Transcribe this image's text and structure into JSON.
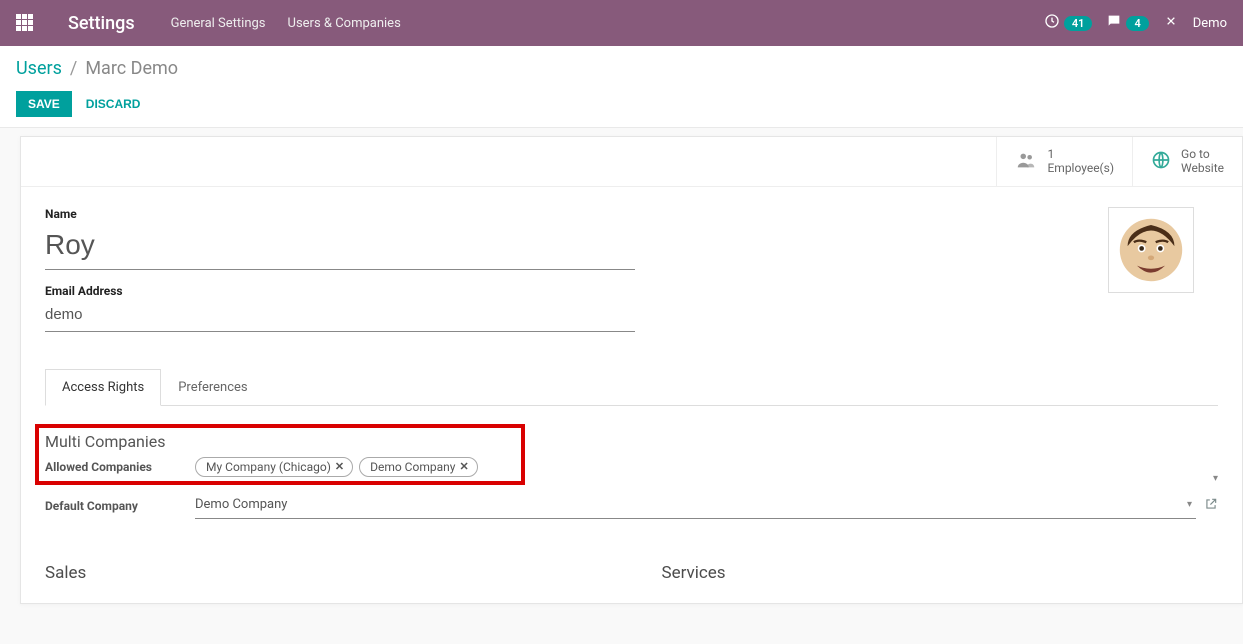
{
  "navbar": {
    "brand": "Settings",
    "links": {
      "general": "General Settings",
      "users_companies": "Users & Companies"
    },
    "badge_activity": "41",
    "badge_discuss": "4",
    "username": "Demo"
  },
  "breadcrumb": {
    "root": "Users",
    "sep": "/",
    "current": "Marc Demo"
  },
  "buttons": {
    "save": "SAVE",
    "discard": "DISCARD"
  },
  "stat": {
    "employees_count": "1",
    "employees_label": "Employee(s)",
    "goto1": "Go to",
    "goto2": "Website"
  },
  "fields": {
    "name_label": "Name",
    "email_label": "Email Address"
  },
  "values": {
    "name": "Roy",
    "email": "demo"
  },
  "tabs": {
    "access": "Access Rights",
    "preferences": "Preferences"
  },
  "sections": {
    "multi_companies": "Multi Companies",
    "allowed_label": "Allowed Companies",
    "default_label": "Default Company",
    "sales": "Sales",
    "services": "Services"
  },
  "allowed_companies": [
    "My Company (Chicago)",
    "Demo Company"
  ],
  "default_company": "Demo Company"
}
